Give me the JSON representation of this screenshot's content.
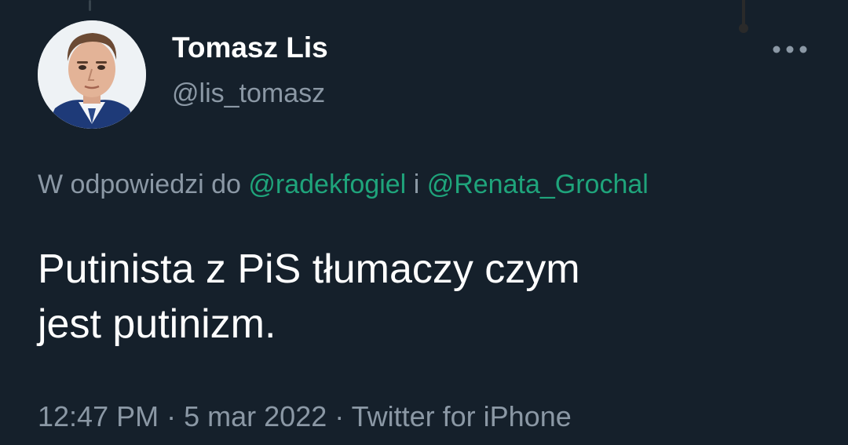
{
  "tweet": {
    "author": {
      "display_name": "Tomasz Lis",
      "handle": "@lis_tomasz"
    },
    "reply_context": {
      "prefix": "W odpowiedzi do",
      "mention_1": "@radekfogiel",
      "separator": "i",
      "mention_2": "@Renata_Grochal"
    },
    "text": "Putinista z PiS tłumaczy czym\njest putinizm.",
    "meta": {
      "time": "12:47 PM",
      "separator": "·",
      "date": "5 mar 2022",
      "source": "Twitter for iPhone"
    }
  },
  "theme": {
    "background": "#15202b",
    "text_primary": "#ffffff",
    "text_secondary": "#8b98a5",
    "link": "#1fa47b"
  },
  "icons": {
    "more": "more-horizontal-icon"
  }
}
